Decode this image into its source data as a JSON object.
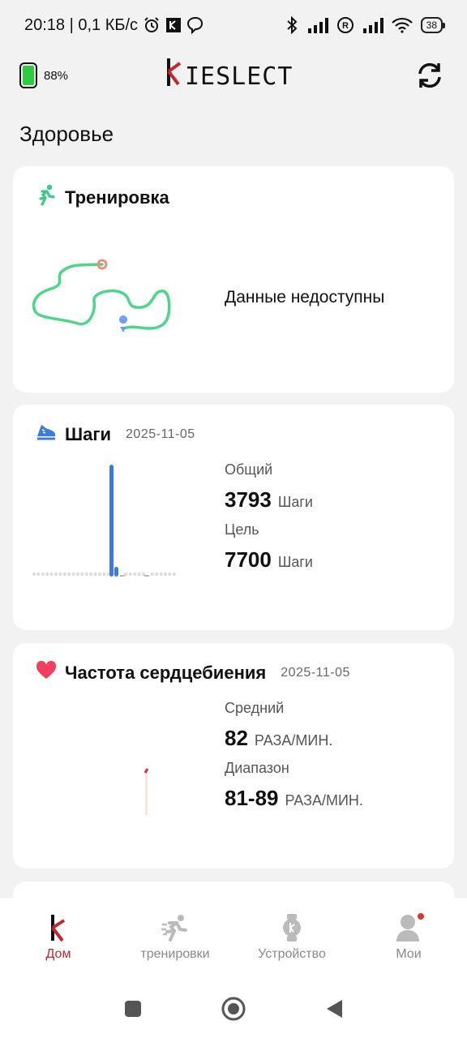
{
  "status_bar": {
    "time_speed": "20:18 | 0,1 КБ/с",
    "battery": "38"
  },
  "header": {
    "watch_battery": "88%",
    "logo_text": "KIESLECT"
  },
  "section_title": "Здоровье",
  "workout_card": {
    "title": "Тренировка",
    "message": "Данные недоступны"
  },
  "steps_card": {
    "title": "Шаги",
    "date": "2025-11-05",
    "total_label": "Общий",
    "total_value": "3793",
    "total_unit": "Шаги",
    "goal_label": "Цель",
    "goal_value": "7700",
    "goal_unit": "Шаги"
  },
  "heart_card": {
    "title": "Частота сердцебиения",
    "date": "2025-11-05",
    "avg_label": "Средний",
    "avg_value": "82",
    "avg_unit": "РАЗА/МИН.",
    "range_label": "Диапазон",
    "range_value": "81-89",
    "range_unit": "РАЗА/МИН."
  },
  "bottom_nav": {
    "items": [
      {
        "label": "Дом"
      },
      {
        "label": "тренировки"
      },
      {
        "label": "Устройство"
      },
      {
        "label": "Мои"
      }
    ]
  },
  "colors": {
    "accent_red": "#c2272d",
    "steps_blue": "#3a7be0",
    "route_green": "#4cd68a",
    "heart_pink": "#f0405f"
  }
}
